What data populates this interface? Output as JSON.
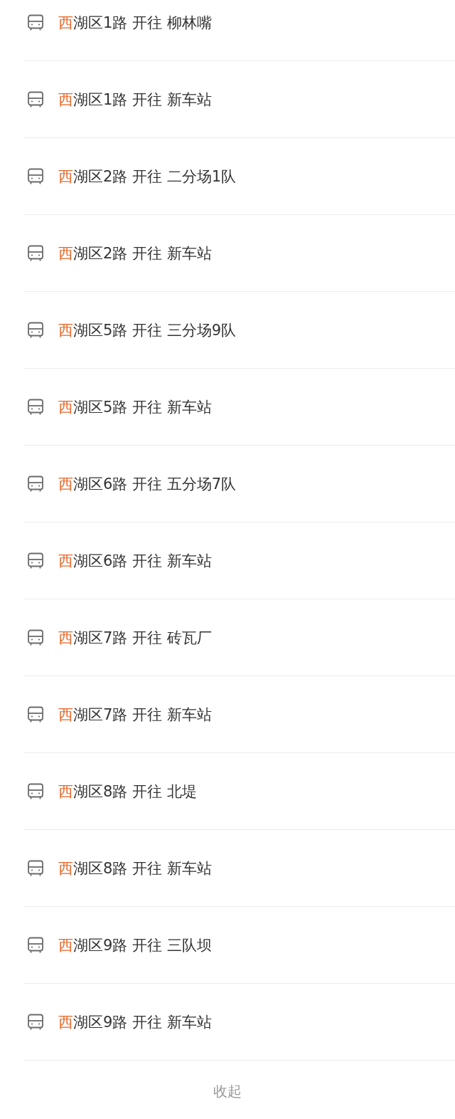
{
  "routes": [
    {
      "match": "西",
      "text": "湖区1路 开往 柳林嘴"
    },
    {
      "match": "西",
      "text": "湖区1路 开往 新车站"
    },
    {
      "match": "西",
      "text": "湖区2路 开往 二分场1队"
    },
    {
      "match": "西",
      "text": "湖区2路 开往 新车站"
    },
    {
      "match": "西",
      "text": "湖区5路 开往 三分场9队"
    },
    {
      "match": "西",
      "text": "湖区5路 开往 新车站"
    },
    {
      "match": "西",
      "text": "湖区6路 开往 五分场7队"
    },
    {
      "match": "西",
      "text": "湖区6路 开往 新车站"
    },
    {
      "match": "西",
      "text": "湖区7路 开往 砖瓦厂"
    },
    {
      "match": "西",
      "text": "湖区7路 开往 新车站"
    },
    {
      "match": "西",
      "text": "湖区8路 开往 北堤"
    },
    {
      "match": "西",
      "text": "湖区8路 开往 新车站"
    },
    {
      "match": "西",
      "text": "湖区9路 开往 三队坝"
    },
    {
      "match": "西",
      "text": "湖区9路 开往 新车站"
    }
  ],
  "collapse_button": "收起"
}
